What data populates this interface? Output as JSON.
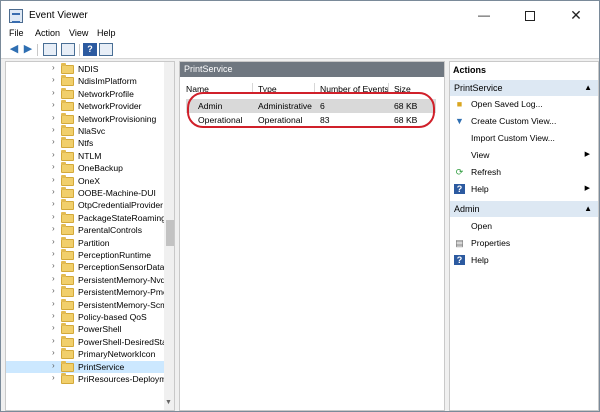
{
  "window": {
    "title": "Event Viewer",
    "minimize": "—",
    "close": "✕"
  },
  "menu": [
    "File",
    "Action",
    "View",
    "Help"
  ],
  "tree": {
    "items": [
      {
        "label": "NDIS",
        "selected": false
      },
      {
        "label": "NdisImPlatform",
        "selected": false
      },
      {
        "label": "NetworkProfile",
        "selected": false
      },
      {
        "label": "NetworkProvider",
        "selected": false
      },
      {
        "label": "NetworkProvisioning",
        "selected": false
      },
      {
        "label": "NlaSvc",
        "selected": false
      },
      {
        "label": "Ntfs",
        "selected": false
      },
      {
        "label": "NTLM",
        "selected": false
      },
      {
        "label": "OneBackup",
        "selected": false
      },
      {
        "label": "OneX",
        "selected": false
      },
      {
        "label": "OOBE-Machine-DUI",
        "selected": false
      },
      {
        "label": "OtpCredentialProvider",
        "selected": false
      },
      {
        "label": "PackageStateRoaming",
        "selected": false
      },
      {
        "label": "ParentalControls",
        "selected": false
      },
      {
        "label": "Partition",
        "selected": false
      },
      {
        "label": "PerceptionRuntime",
        "selected": false
      },
      {
        "label": "PerceptionSensorDataSe",
        "selected": false
      },
      {
        "label": "PersistentMemory-Nvdi",
        "selected": false
      },
      {
        "label": "PersistentMemory-Pmer",
        "selected": false
      },
      {
        "label": "PersistentMemory-ScmE",
        "selected": false
      },
      {
        "label": "Policy-based QoS",
        "selected": false
      },
      {
        "label": "PowerShell",
        "selected": false
      },
      {
        "label": "PowerShell-DesiredState",
        "selected": false
      },
      {
        "label": "PrimaryNetworkIcon",
        "selected": false
      },
      {
        "label": "PrintService",
        "selected": true
      },
      {
        "label": "PriResources-Deployme",
        "selected": false
      }
    ]
  },
  "center": {
    "header": "PrintService",
    "columns": [
      "Name",
      "Type",
      "Number of Events",
      "Size"
    ],
    "rows": [
      {
        "name": "Admin",
        "type": "Administrative",
        "events": "6",
        "size": "68 KB"
      },
      {
        "name": "Operational",
        "type": "Operational",
        "events": "83",
        "size": "68 KB"
      }
    ]
  },
  "actions": {
    "header": "Actions",
    "section1": {
      "title": "PrintService",
      "items": [
        {
          "label": "Open Saved Log...",
          "icon": "folder-open-icon",
          "submenu": false
        },
        {
          "label": "Create Custom View...",
          "icon": "filter-icon",
          "submenu": false
        },
        {
          "label": "Import Custom View...",
          "icon": "",
          "submenu": false
        },
        {
          "label": "View",
          "icon": "",
          "submenu": true
        },
        {
          "label": "Refresh",
          "icon": "refresh-icon",
          "submenu": false
        },
        {
          "label": "Help",
          "icon": "help-icon",
          "submenu": true
        }
      ]
    },
    "section2": {
      "title": "Admin",
      "items": [
        {
          "label": "Open",
          "icon": "",
          "submenu": false
        },
        {
          "label": "Properties",
          "icon": "properties-icon",
          "submenu": false
        },
        {
          "label": "Help",
          "icon": "help-icon",
          "submenu": false
        }
      ]
    }
  },
  "colors": {
    "highlight": "#d0202a",
    "selected": "#cce8ff",
    "paneHeader": "#6f7780",
    "sectionBg": "#dde8f3"
  }
}
